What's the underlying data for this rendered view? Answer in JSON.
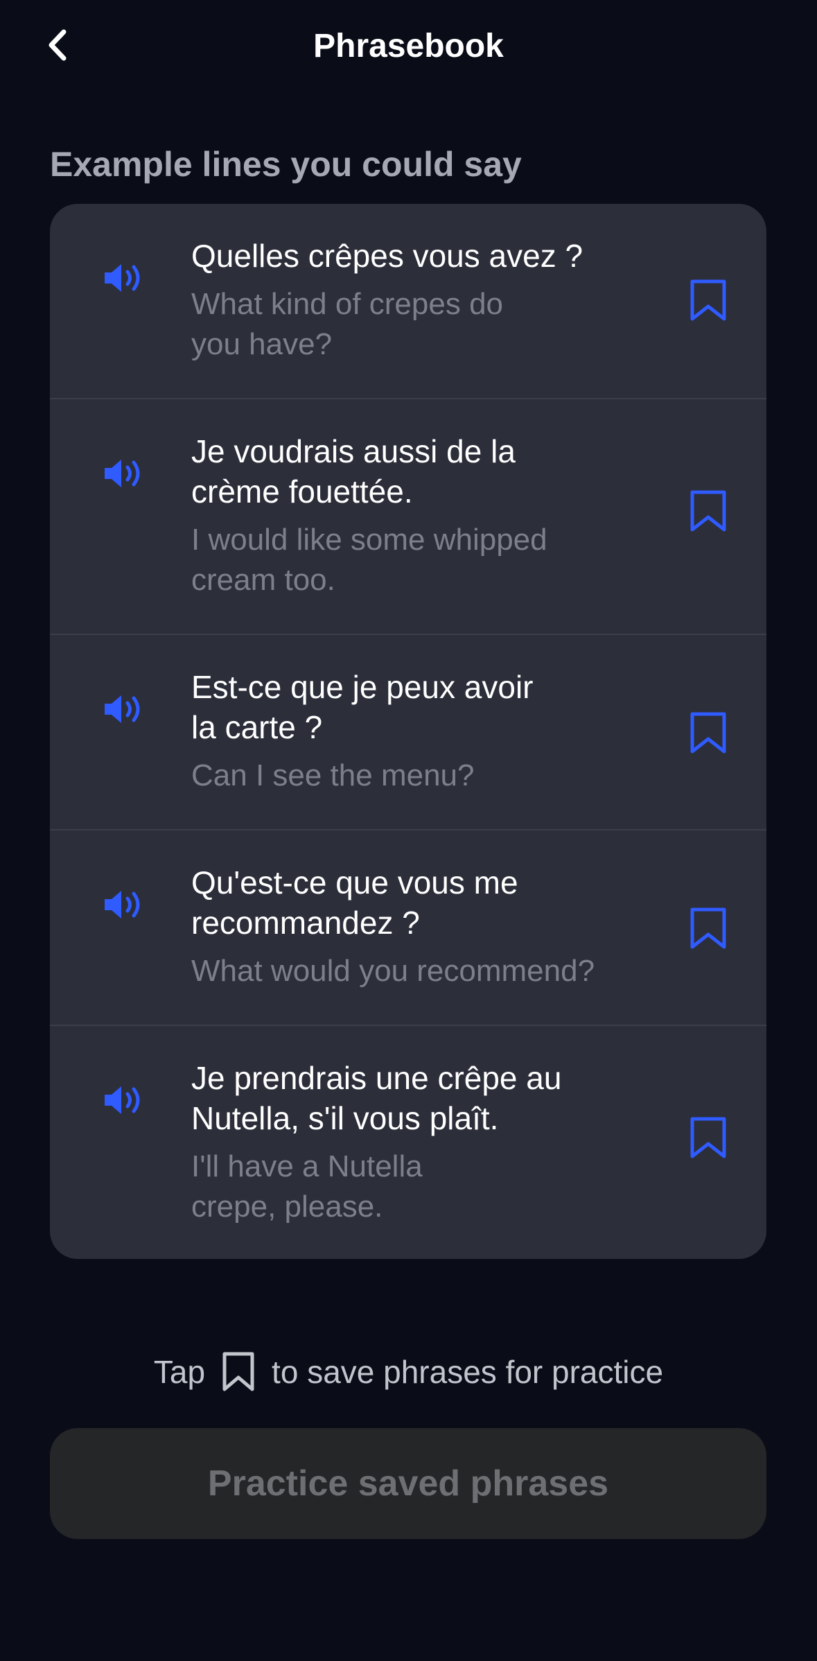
{
  "header": {
    "title": "Phrasebook",
    "back_icon": "chevron-left-icon"
  },
  "section": {
    "label": "Example lines you could say"
  },
  "phrases": [
    {
      "french": "Quelles crêpes vous avez ?",
      "english": "What kind of crepes do\nyou have?"
    },
    {
      "french": "Je voudrais aussi de la\ncrème fouettée.",
      "english": "I would like some whipped\ncream too."
    },
    {
      "french": "Est-ce que je peux avoir\nla carte ?",
      "english": "Can I see the menu?"
    },
    {
      "french": "Qu'est-ce que vous me\nrecommandez ?",
      "english": "What would you recommend?"
    },
    {
      "french": "Je prendrais une crêpe au\nNutella, s'il vous plaît.",
      "english": "I'll have a Nutella\ncrepe, please."
    }
  ],
  "icons": {
    "speaker": "speaker-icon",
    "bookmark": "bookmark-icon"
  },
  "hint": {
    "prefix": "Tap",
    "suffix": "to save phrases for practice"
  },
  "practice_button": {
    "label": "Practice saved phrases"
  },
  "colors": {
    "background": "#0a0d18",
    "card": "#2c2e3a",
    "accent": "#2f5bff",
    "muted_text": "#7d808b",
    "disabled_button": "#252628"
  }
}
